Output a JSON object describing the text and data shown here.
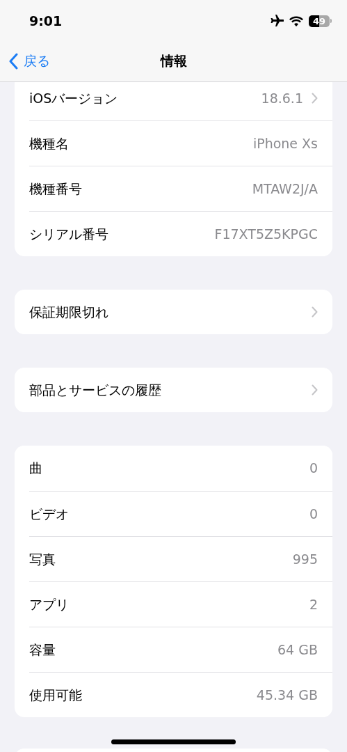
{
  "status_bar": {
    "time": "9:01",
    "battery": "49"
  },
  "nav": {
    "back": "戻る",
    "title": "情報"
  },
  "groups": [
    {
      "rows": [
        {
          "label": "iOSバージョン",
          "value": "18.6.1",
          "chevron": true
        },
        {
          "label": "機種名",
          "value": "iPhone Xs",
          "chevron": false
        },
        {
          "label": "機種番号",
          "value": "MTAW2J/A",
          "chevron": false
        },
        {
          "label": "シリアル番号",
          "value": "F17XT5Z5KPGC",
          "chevron": false
        }
      ]
    },
    {
      "rows": [
        {
          "label": "保証期限切れ",
          "chevron": true
        }
      ]
    },
    {
      "rows": [
        {
          "label": "部品とサービスの履歴",
          "chevron": true
        }
      ]
    },
    {
      "rows": [
        {
          "label": "曲",
          "value": "0",
          "chevron": false
        },
        {
          "label": "ビデオ",
          "value": "0",
          "chevron": false
        },
        {
          "label": "写真",
          "value": "995",
          "chevron": false
        },
        {
          "label": "アプリ",
          "value": "2",
          "chevron": false
        },
        {
          "label": "容量",
          "value": "64 GB",
          "chevron": false
        },
        {
          "label": "使用可能",
          "value": "45.34 GB",
          "chevron": false
        }
      ]
    }
  ]
}
